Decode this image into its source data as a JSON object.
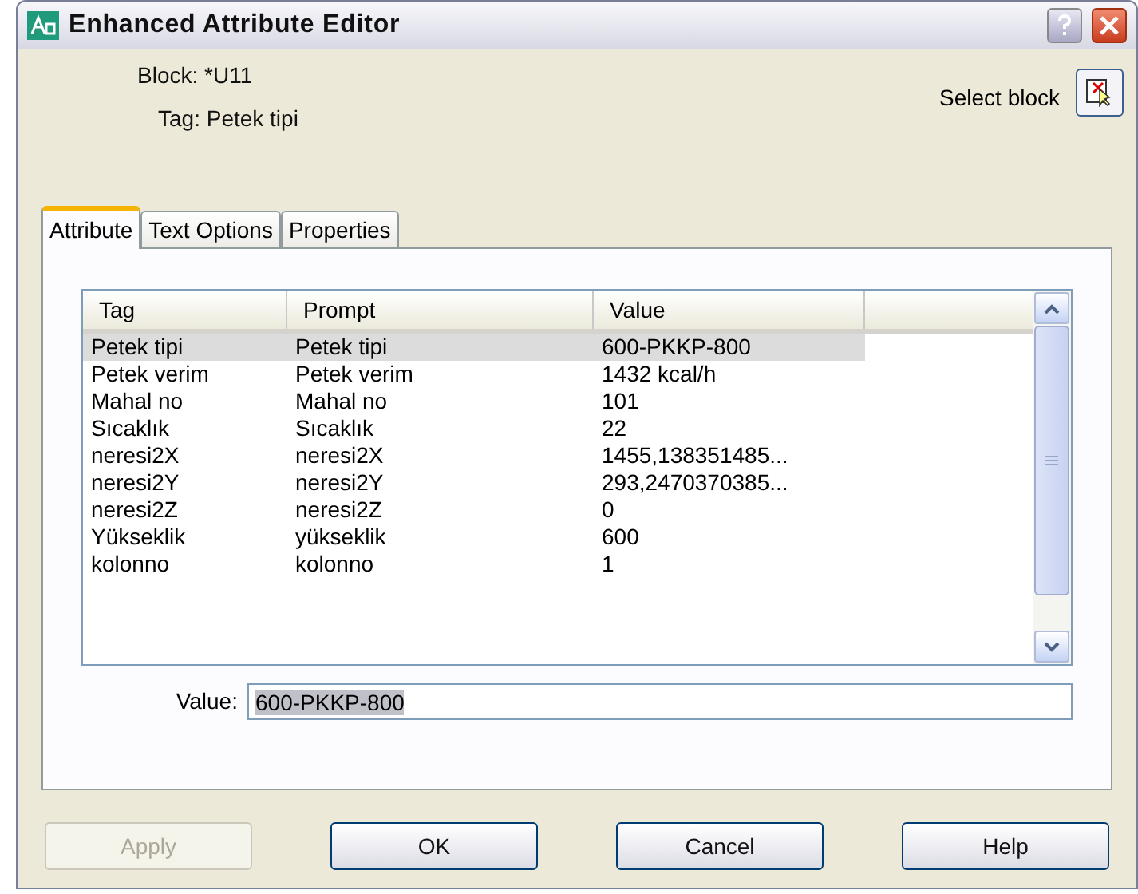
{
  "window": {
    "title": "Enhanced Attribute Editor"
  },
  "block": "Block: *U11",
  "tag": "Tag: Petek tipi",
  "select_block": "Select block",
  "tabs": [
    {
      "label": "Attribute",
      "selected": true
    },
    {
      "label": "Text Options",
      "selected": false
    },
    {
      "label": "Properties",
      "selected": false
    }
  ],
  "table": {
    "columns": [
      "Tag",
      "Prompt",
      "Value"
    ],
    "rows": [
      {
        "cells": [
          "Petek tipi",
          "Petek tipi",
          "600-PKKP-800"
        ],
        "selected": true
      },
      {
        "cells": [
          "Petek verim",
          "Petek verim",
          "1432 kcal/h"
        ],
        "selected": false
      },
      {
        "cells": [
          "Mahal no",
          "Mahal no",
          "101"
        ],
        "selected": false
      },
      {
        "cells": [
          "Sıcaklık",
          "Sıcaklık",
          "22"
        ],
        "selected": false
      },
      {
        "cells": [
          "neresi2X",
          "neresi2X",
          "1455,138351485..."
        ],
        "selected": false
      },
      {
        "cells": [
          "neresi2Y",
          "neresi2Y",
          "293,2470370385..."
        ],
        "selected": false
      },
      {
        "cells": [
          "neresi2Z",
          "neresi2Z",
          "0"
        ],
        "selected": false
      },
      {
        "cells": [
          "Yükseklik",
          "yükseklik",
          "600"
        ],
        "selected": false
      },
      {
        "cells": [
          "kolonno",
          "kolonno",
          "1"
        ],
        "selected": false
      }
    ]
  },
  "value_label": "Value:",
  "value": "600-PKKP-800",
  "buttons": [
    {
      "label": "Apply",
      "disabled": true
    },
    {
      "label": "OK",
      "disabled": false
    },
    {
      "label": "Cancel",
      "disabled": false
    },
    {
      "label": "Help",
      "disabled": false
    }
  ]
}
